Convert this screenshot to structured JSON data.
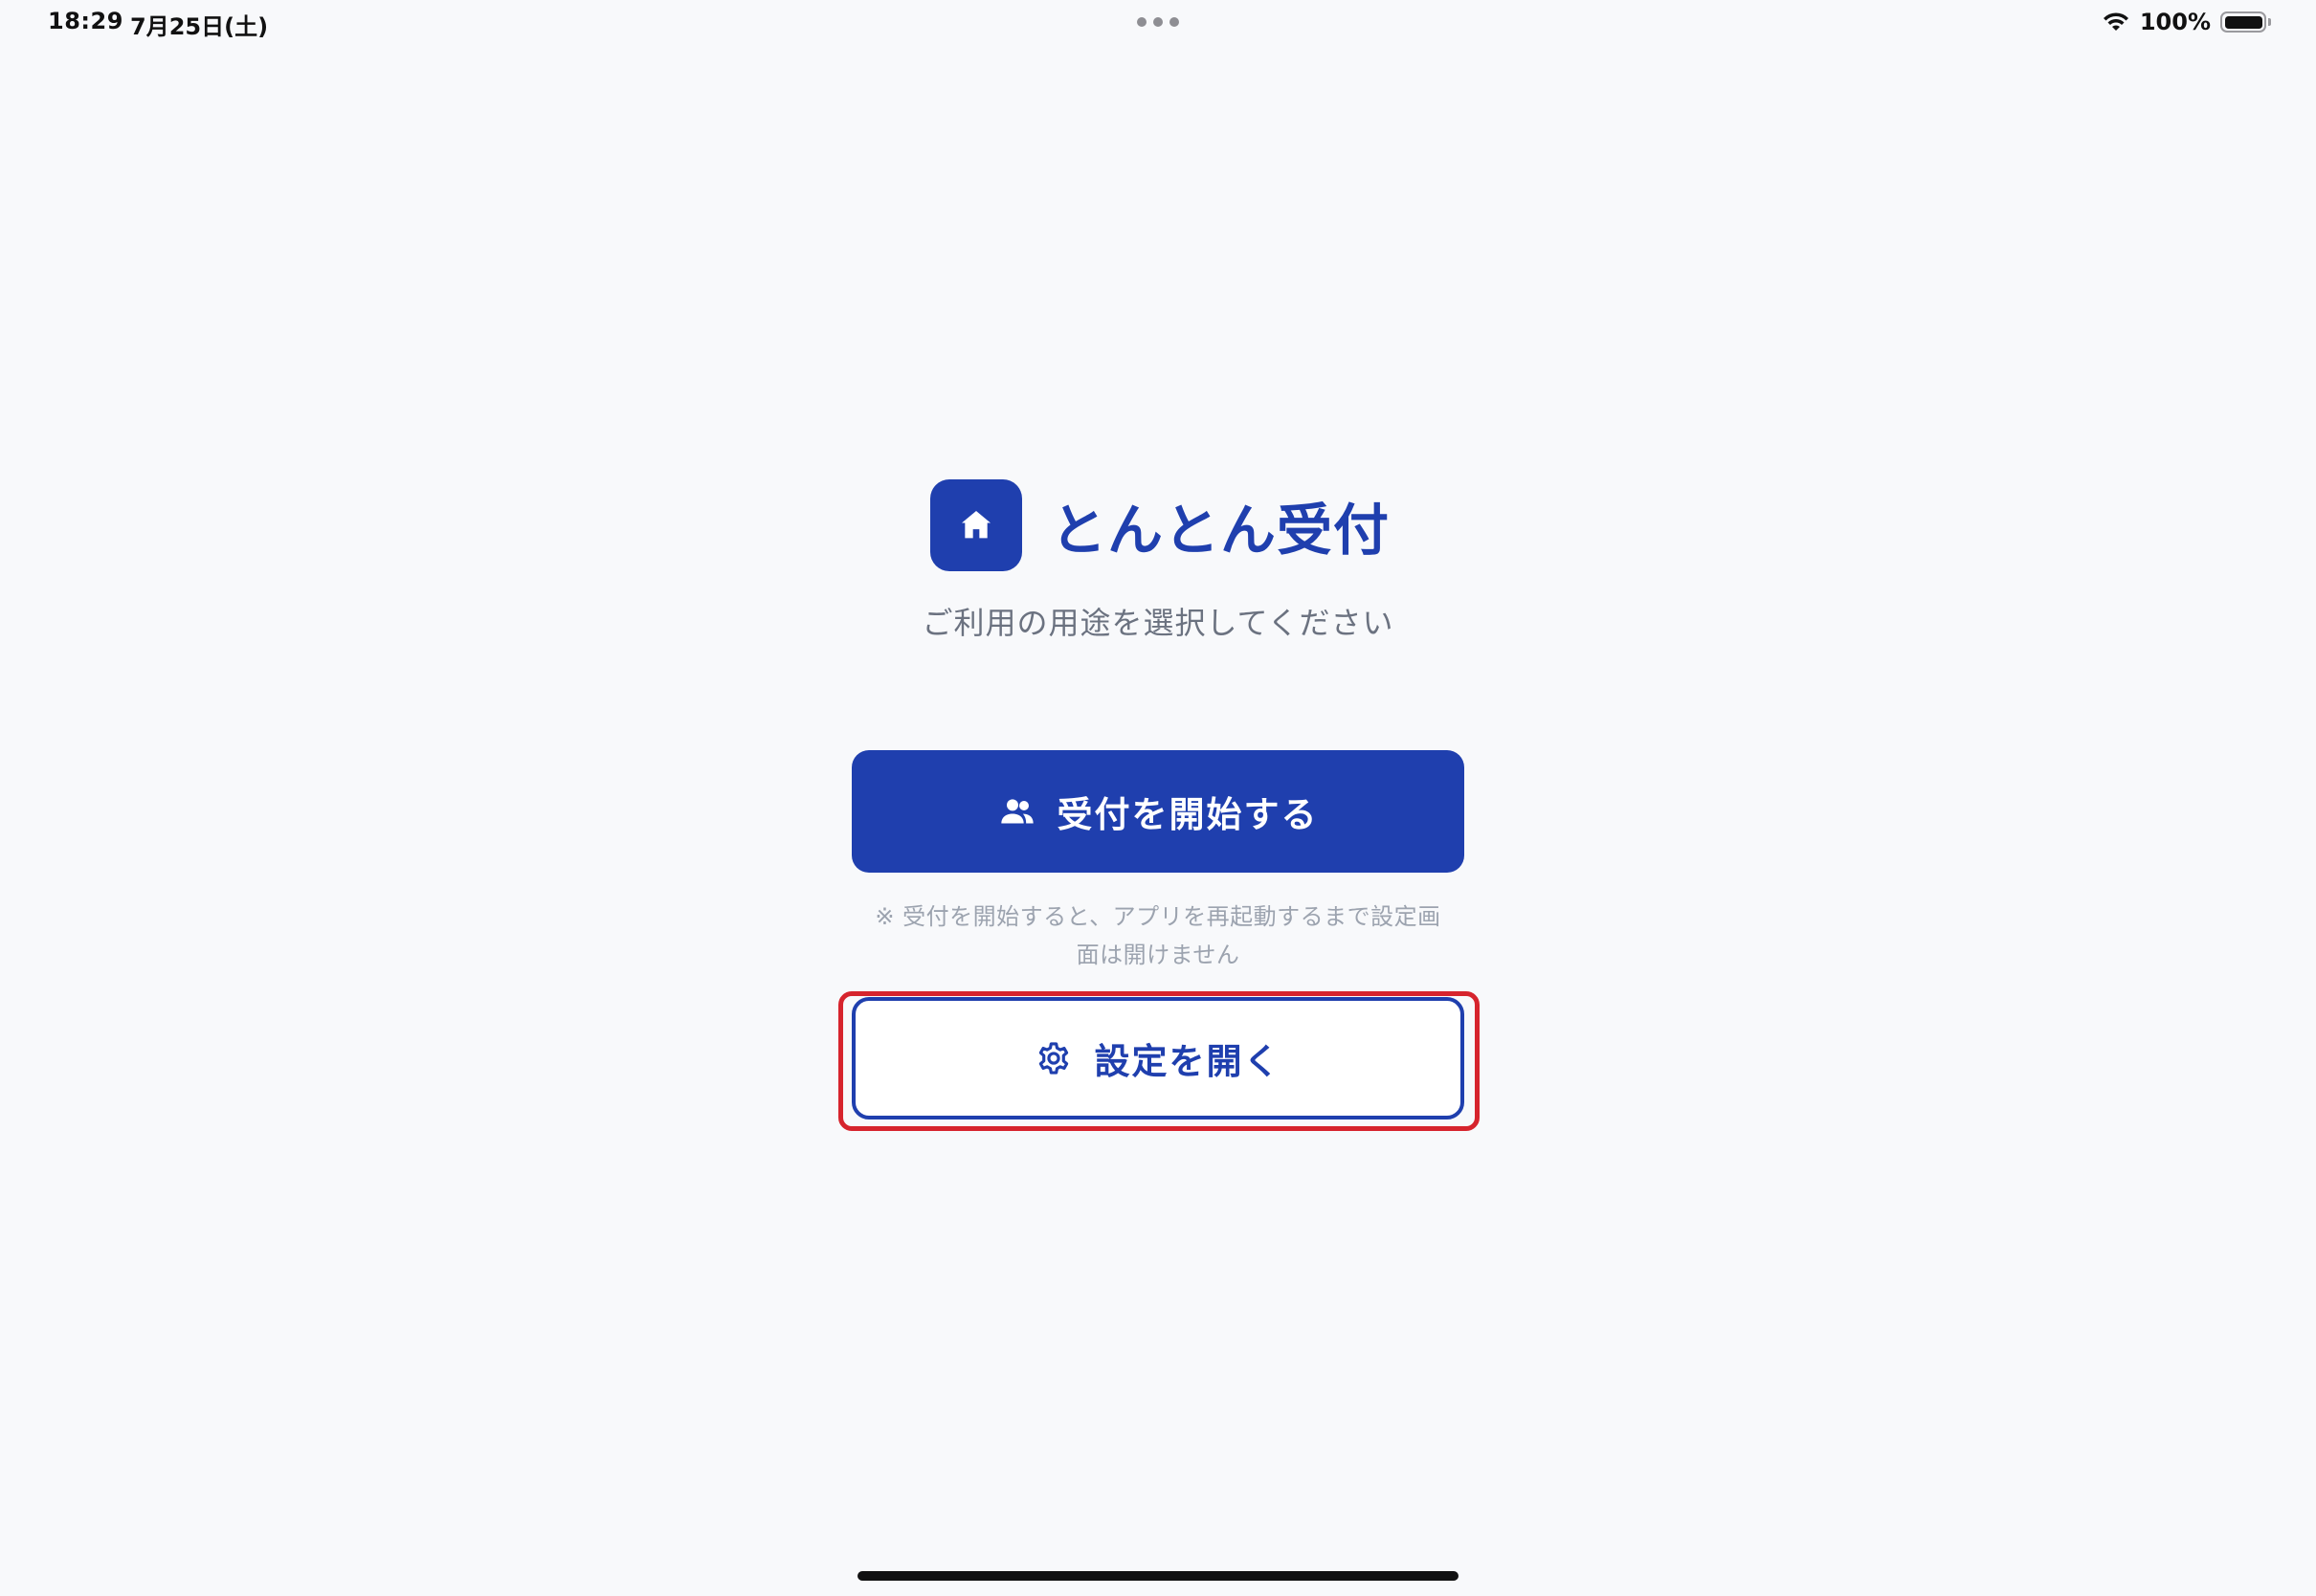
{
  "status_bar": {
    "time": "18:29",
    "date": "7月25日(土)",
    "battery_percent": "100%",
    "battery_level": 1.0,
    "icons": [
      "wifi-icon",
      "battery-icon",
      "more-dots-icon"
    ]
  },
  "app": {
    "title": "とんとん受付",
    "logo_icon": "home-icon",
    "subtitle": "ご利用の用途を選択してください"
  },
  "actions": {
    "start": {
      "label": "受付を開始する",
      "icon": "people-icon"
    },
    "note_line1": "※ 受付を開始すると、アプリを再起動するまで設定画",
    "note_line2": "面は開けません",
    "settings": {
      "label": "設定を開く",
      "icon": "gear-icon",
      "highlighted": true
    }
  },
  "colors": {
    "primary": "#1f3fae",
    "background": "#f8f9fb",
    "highlight": "#d6242d",
    "muted_text": "#6b7280",
    "note_text": "#9ca3af"
  }
}
